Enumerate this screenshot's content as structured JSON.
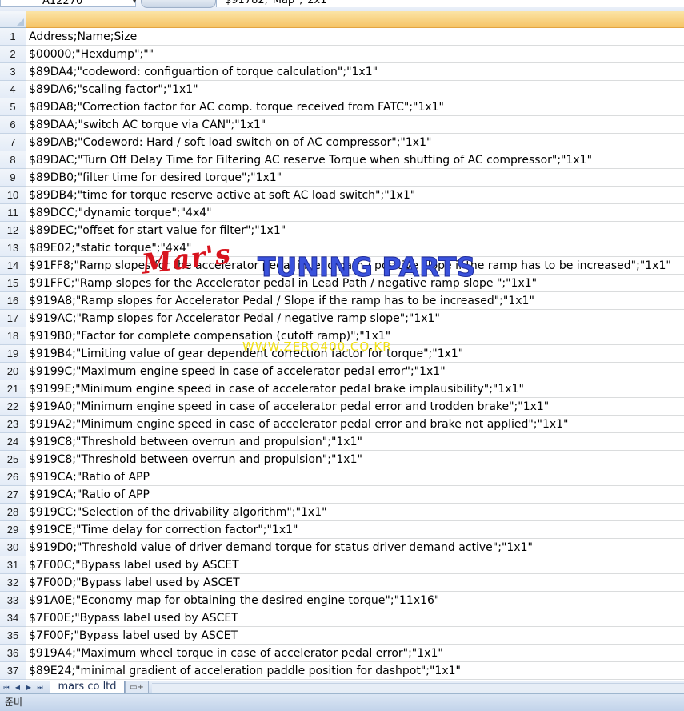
{
  "formula_bar": {
    "name_box": "A12270",
    "formula": "$91782,\"Map\",\"2x1\""
  },
  "rows": [
    {
      "num": "1",
      "value": "Address;Name;Size"
    },
    {
      "num": "2",
      "value": "$00000;\"Hexdump\";\"\""
    },
    {
      "num": "3",
      "value": "$89DA4;\"codeword: configuartion of torque calculation\";\"1x1\""
    },
    {
      "num": "4",
      "value": "$89DA6;\"scaling factor\";\"1x1\""
    },
    {
      "num": "5",
      "value": "$89DA8;\"Correction factor for AC comp. torque received from FATC\";\"1x1\""
    },
    {
      "num": "6",
      "value": "$89DAA;\"switch AC torque via CAN\";\"1x1\""
    },
    {
      "num": "7",
      "value": "$89DAB;\"Codeword: Hard / soft load switch on of AC compressor\";\"1x1\""
    },
    {
      "num": "8",
      "value": "$89DAC;\"Turn Off Delay Time for Filtering AC reserve Torque when shutting of AC compressor\";\"1x1\""
    },
    {
      "num": "9",
      "value": "$89DB0;\"filter time for desired torque\";\"1x1\""
    },
    {
      "num": "10",
      "value": "$89DB4;\"time for torque reserve active at soft AC load switch\";\"1x1\""
    },
    {
      "num": "11",
      "value": "$89DCC;\"dynamic torque\";\"4x4\""
    },
    {
      "num": "12",
      "value": "$89DEC;\"offset for start value for filter\";\"1x1\""
    },
    {
      "num": "13",
      "value": "$89E02;\"static torque\";\"4x4\""
    },
    {
      "num": "14",
      "value": "$91FF8;\"Ramp slopes for the accelerator pedal in lead path / positive slope if the ramp has to be increased\";\"1x1\""
    },
    {
      "num": "15",
      "value": "$91FFC;\"Ramp slopes for the Accelerator pedal in Lead Path / negative ramp slope \";\"1x1\""
    },
    {
      "num": "16",
      "value": "$919A8;\"Ramp slopes for Accelerator Pedal / Slope if the ramp has to be increased\";\"1x1\""
    },
    {
      "num": "17",
      "value": "$919AC;\"Ramp slopes for Accelerator Pedal / negative ramp slope\";\"1x1\""
    },
    {
      "num": "18",
      "value": "$919B0;\"Factor for complete compensation (cutoff ramp)\";\"1x1\""
    },
    {
      "num": "19",
      "value": "$919B4;\"Limiting value of gear dependent correction factor for torque\";\"1x1\""
    },
    {
      "num": "20",
      "value": "$9199C;\"Maximum engine speed in case of accelerator pedal error\";\"1x1\""
    },
    {
      "num": "21",
      "value": "$9199E;\"Minimum engine speed in case of accelerator pedal brake implausibility\";\"1x1\""
    },
    {
      "num": "22",
      "value": "$919A0;\"Minimum engine speed in case of accelerator pedal error and trodden brake\";\"1x1\""
    },
    {
      "num": "23",
      "value": "$919A2;\"Minimum engine speed in case of accelerator pedal error and brake not applied\";\"1x1\""
    },
    {
      "num": "24",
      "value": "$919C8;\"Threshold between overrun and propulsion\";\"1x1\""
    },
    {
      "num": "25",
      "value": "$919C8;\"Threshold between overrun and propulsion\";\"1x1\""
    },
    {
      "num": "26",
      "value": "$919CA;\"Ratio of APP"
    },
    {
      "num": "27",
      "value": "$919CA;\"Ratio of APP"
    },
    {
      "num": "28",
      "value": "$919CC;\"Selection of the drivability algorithm\";\"1x1\""
    },
    {
      "num": "29",
      "value": "$919CE;\"Time delay for correction factor\";\"1x1\""
    },
    {
      "num": "30",
      "value": "$919D0;\"Threshold value of driver demand torque for status driver demand active\";\"1x1\""
    },
    {
      "num": "31",
      "value": "$7F00C;\"Bypass label used by ASCET"
    },
    {
      "num": "32",
      "value": "$7F00D;\"Bypass label used by ASCET"
    },
    {
      "num": "33",
      "value": "$91A0E;\"Economy map for obtaining the desired engine torque\";\"11x16\""
    },
    {
      "num": "34",
      "value": "$7F00E;\"Bypass label used by ASCET"
    },
    {
      "num": "35",
      "value": "$7F00F;\"Bypass label used by ASCET"
    },
    {
      "num": "36",
      "value": "$919A4;\"Maximum wheel torque in case of accelerator pedal error\";\"1x1\""
    },
    {
      "num": "37",
      "value": "$89E24;\"minimal gradient of acceleration paddle position for dashpot\";\"1x1\""
    }
  ],
  "watermark": {
    "script": "Mar's",
    "title": "TUNING PARTS",
    "url": "WWW.ZERO400.CO.KR"
  },
  "sheet_tabs": {
    "active": "mars co ltd",
    "nav": [
      "⏮",
      "◀",
      "▶",
      "⏭"
    ]
  },
  "status_bar": {
    "text": "준비"
  }
}
